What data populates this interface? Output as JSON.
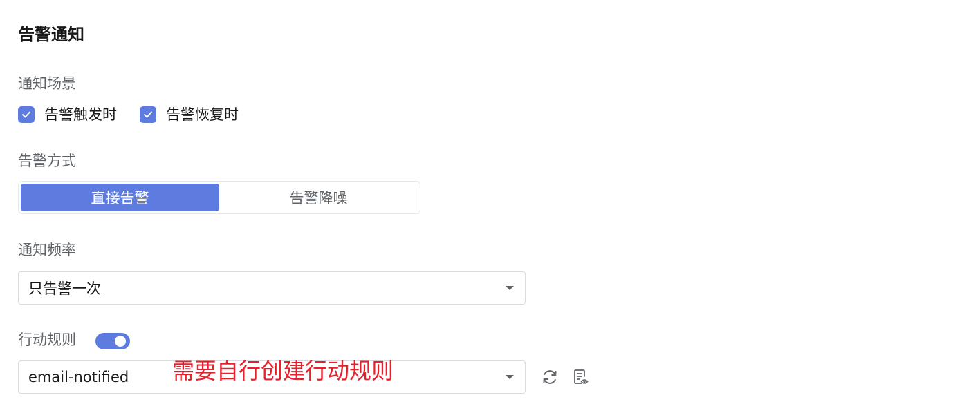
{
  "section": {
    "title": "告警通知"
  },
  "notify_scene": {
    "label": "通知场景",
    "options": [
      {
        "label": "告警触发时",
        "checked": true
      },
      {
        "label": "告警恢复时",
        "checked": true
      }
    ]
  },
  "alarm_mode": {
    "label": "告警方式",
    "options": [
      "直接告警",
      "告警降噪"
    ],
    "selected": "直接告警"
  },
  "notify_frequency": {
    "label": "通知频率",
    "value": "只告警一次"
  },
  "action_rule": {
    "label": "行动规则",
    "enabled": true,
    "value": "email-notified",
    "annotation": "需要自行创建行动规则"
  },
  "icons": {
    "checkbox_check": "check-icon",
    "dropdown_caret": "caret-down-icon",
    "refresh": "refresh-icon",
    "view_rule": "document-eye-icon"
  },
  "colors": {
    "accent": "#5e7ce0",
    "annotation": "#e8202b"
  }
}
